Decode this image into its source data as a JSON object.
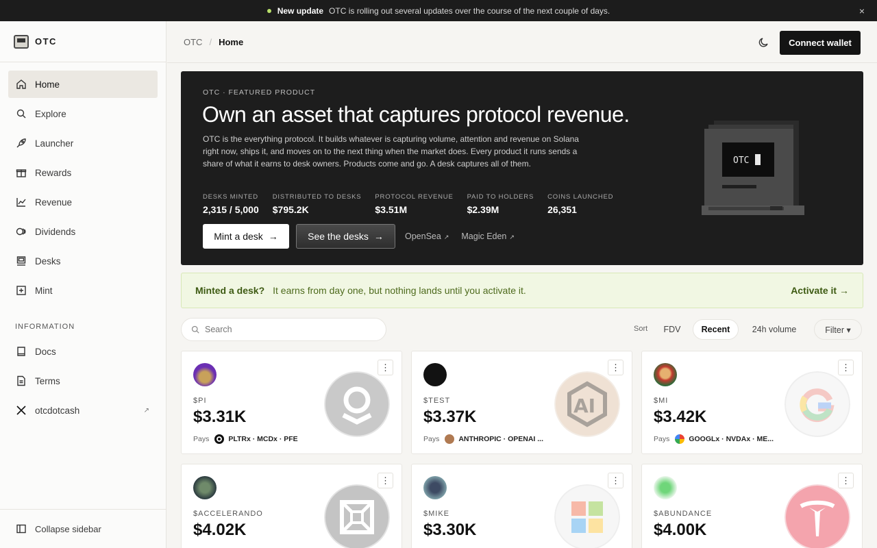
{
  "announcement": {
    "title": "New update",
    "text": "OTC is rolling out several updates over the course of the next couple of days.",
    "close": "×"
  },
  "brand": {
    "name": "OTC"
  },
  "nav": {
    "items": [
      {
        "label": "Home",
        "icon": "home-icon",
        "active": true
      },
      {
        "label": "Explore",
        "icon": "search-icon"
      },
      {
        "label": "Launcher",
        "icon": "rocket-icon"
      },
      {
        "label": "Rewards",
        "icon": "gift-icon"
      },
      {
        "label": "Revenue",
        "icon": "chart-icon"
      },
      {
        "label": "Dividends",
        "icon": "coins-icon"
      },
      {
        "label": "Desks",
        "icon": "computer-icon"
      },
      {
        "label": "Mint",
        "icon": "plus-square-icon"
      }
    ],
    "section_label": "INFORMATION",
    "info_items": [
      {
        "label": "Docs",
        "icon": "book-icon"
      },
      {
        "label": "Terms",
        "icon": "document-icon"
      },
      {
        "label": "otcdotcash",
        "icon": "x-logo-icon",
        "external": "↗"
      }
    ],
    "collapse_label": "Collapse sidebar"
  },
  "header": {
    "root": "OTC",
    "separator": "/",
    "current": "Home",
    "connect_label": "Connect wallet"
  },
  "hero": {
    "eyebrow": "OTC · FEATURED PRODUCT",
    "title": "Own an asset that captures protocol revenue.",
    "description": "OTC is the everything protocol. It builds whatever is capturing volume, attention and revenue on Solana right now, ships it, and moves on to the next thing when the market does. Every product it runs sends a share of what it earns to desk owners. Products come and go. A desk captures all of them.",
    "stats": [
      {
        "label": "DESKS MINTED",
        "value": "2,315 / 5,000"
      },
      {
        "label": "DISTRIBUTED TO DESKS",
        "value": "$795.2K"
      },
      {
        "label": "PROTOCOL REVENUE",
        "value": "$3.51M"
      },
      {
        "label": "PAID TO HOLDERS",
        "value": "$2.39M"
      },
      {
        "label": "COINS LAUNCHED",
        "value": "26,351"
      }
    ],
    "mint_label": "Mint a desk",
    "see_label": "See the desks",
    "arrow": "→",
    "links": [
      {
        "label": "OpenSea",
        "suffix": "↗"
      },
      {
        "label": "Magic Eden",
        "suffix": "↗"
      }
    ],
    "art_text": "OTC"
  },
  "banner": {
    "question": "Minted a desk?",
    "message": "It earns from day one, but nothing lands until you activate it.",
    "action": "Activate it →"
  },
  "toolbar": {
    "search_placeholder": "Search",
    "sort_label": "Sort",
    "sort_options": [
      "FDV",
      "Recent",
      "24h volume"
    ],
    "sort_selected": "Recent",
    "filter_label": "Filter ▾"
  },
  "cards": [
    {
      "ticker": "$PI",
      "price": "$3.31K",
      "pays_label": "Pays",
      "pays": "PLTRx · MCDx · PFE",
      "menu": "⋮",
      "coin_icon": "palantir-icon"
    },
    {
      "ticker": "$TEST",
      "price": "$3.37K",
      "pays_label": "Pays",
      "pays": "ANTHROPIC · OPENAI ...",
      "menu": "⋮",
      "coin_icon": "anthropic-icon"
    },
    {
      "ticker": "$MI",
      "price": "$3.42K",
      "pays_label": "Pays",
      "pays": "GOOGLx · NVDAx · ME...",
      "menu": "⋮",
      "coin_icon": "google-icon"
    },
    {
      "ticker": "$ACCELERANDO",
      "price": "$4.02K",
      "menu": "⋮",
      "coin_icon": "frame-icon"
    },
    {
      "ticker": "$MIKE",
      "price": "$3.30K",
      "menu": "⋮",
      "coin_icon": "microsoft-icon"
    },
    {
      "ticker": "$ABUNDANCE",
      "price": "$4.00K",
      "menu": "⋮",
      "coin_icon": "tesla-icon"
    }
  ]
}
